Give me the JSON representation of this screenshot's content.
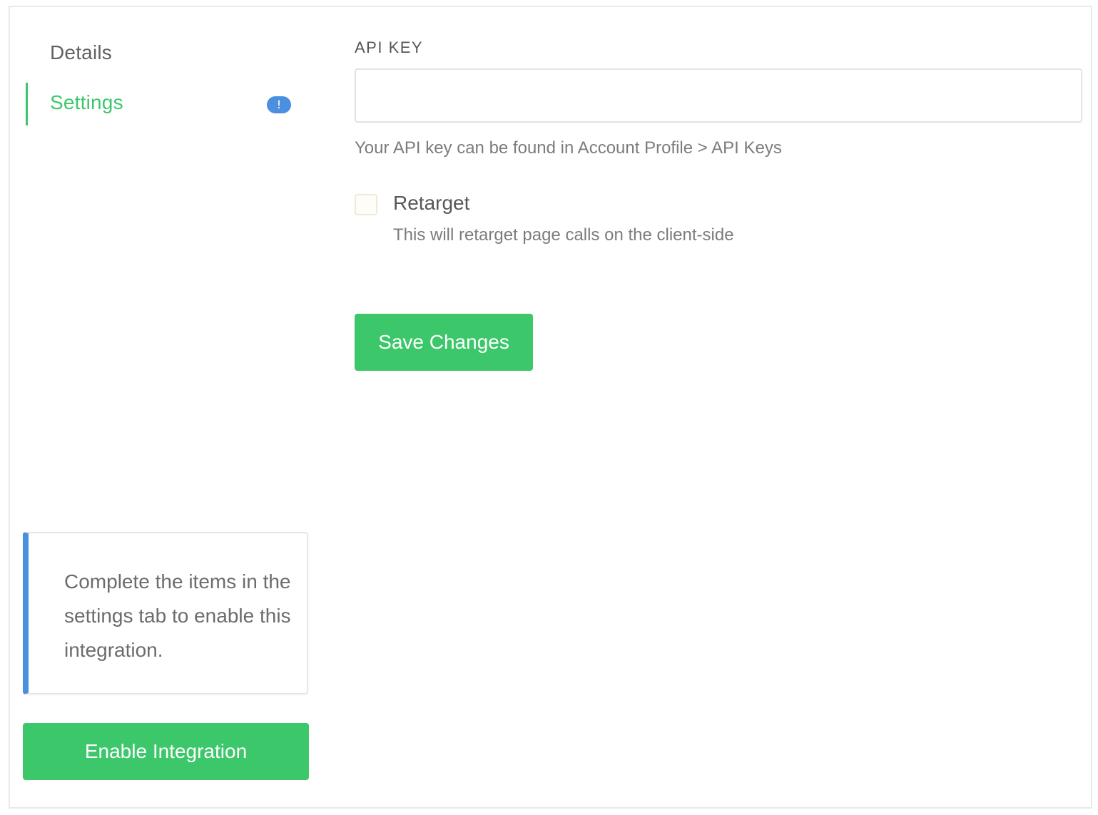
{
  "sidebar": {
    "items": [
      {
        "label": "Details",
        "active": false
      },
      {
        "label": "Settings",
        "active": true,
        "badge": "!"
      }
    ],
    "notice": {
      "text": "Complete the items in the settings tab to enable this integration."
    },
    "enable_button_label": "Enable Integration"
  },
  "settings": {
    "api_key": {
      "label": "API KEY",
      "value": "",
      "placeholder": "",
      "help": "Your API key can be found in Account Profile > API Keys"
    },
    "retarget": {
      "label": "Retarget",
      "checked": false,
      "description": "This will retarget page calls on the client-side"
    },
    "save_label": "Save Changes"
  },
  "colors": {
    "accent_green": "#3cc76a",
    "accent_blue": "#4a8fe0",
    "border": "#e9e9e9"
  },
  "icons": {
    "badge": "alert-exclamation-icon"
  }
}
